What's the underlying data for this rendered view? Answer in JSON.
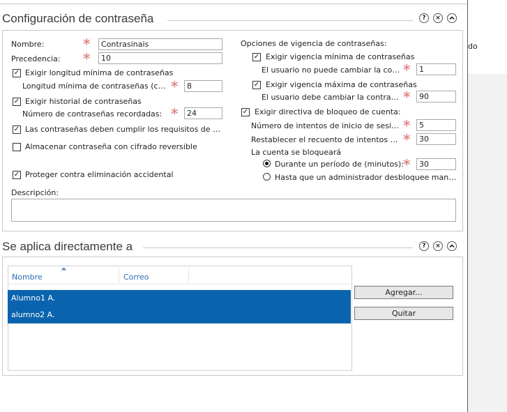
{
  "right_pane": {
    "fragment": "do"
  },
  "config": {
    "title": "Configuración de contraseña",
    "controls": {
      "help": "?",
      "close": "×",
      "collapse": "^"
    },
    "nombre_label": "Nombre:",
    "nombre_value": "Contrasinais",
    "precedencia_label": "Precedencia:",
    "precedencia_value": "10",
    "min_length_check": "Exigir longitud mínima de contraseñas",
    "min_length_label": "Longitud mínima de contraseñas (cara...",
    "min_length_value": "8",
    "history_check": "Exigir historial de contraseñas",
    "history_label": "Número de contraseñas recordadas:",
    "history_value": "24",
    "complexity_check": "Las contraseñas deben cumplir los requisitos de co...",
    "reversible_check": "Almacenar contraseña con cifrado reversible",
    "protect_check": "Proteger contra eliminación accidental",
    "description_label": "Descripción:",
    "description_value": "",
    "vigencia_title": "Opciones de vigencia de contraseñas:",
    "min_age_check": "Exigir vigencia mínima de contraseñas",
    "min_age_label": "El usuario no puede cambiar la cont...",
    "min_age_value": "1",
    "max_age_check": "Exigir vigencia máxima de contraseñas",
    "max_age_label": "El usuario debe cambiar la contrase...",
    "max_age_value": "90",
    "lockout_check": "Exigir directiva de bloqueo de cuenta:",
    "attempts_label": "Número de intentos de inicio de sesió...",
    "attempts_value": "5",
    "reset_label": "Restablecer el recuento de intentos de...",
    "reset_value": "30",
    "locked_title": "La cuenta se bloqueará",
    "duration_radio": "Durante un período de (minutos):",
    "duration_value": "30",
    "admin_radio": "Hasta que un administrador desbloquee manua..."
  },
  "applies": {
    "title": "Se aplica directamente a",
    "controls": {
      "help": "?",
      "close": "×",
      "collapse": "^"
    },
    "columns": [
      "Nombre",
      "Correo"
    ],
    "rows": [
      {
        "name": "Alumno1 A.",
        "mail": ""
      },
      {
        "name": "alumno2 A.",
        "mail": ""
      }
    ],
    "add_button": "Agregar...",
    "remove_button": "Quitar"
  }
}
